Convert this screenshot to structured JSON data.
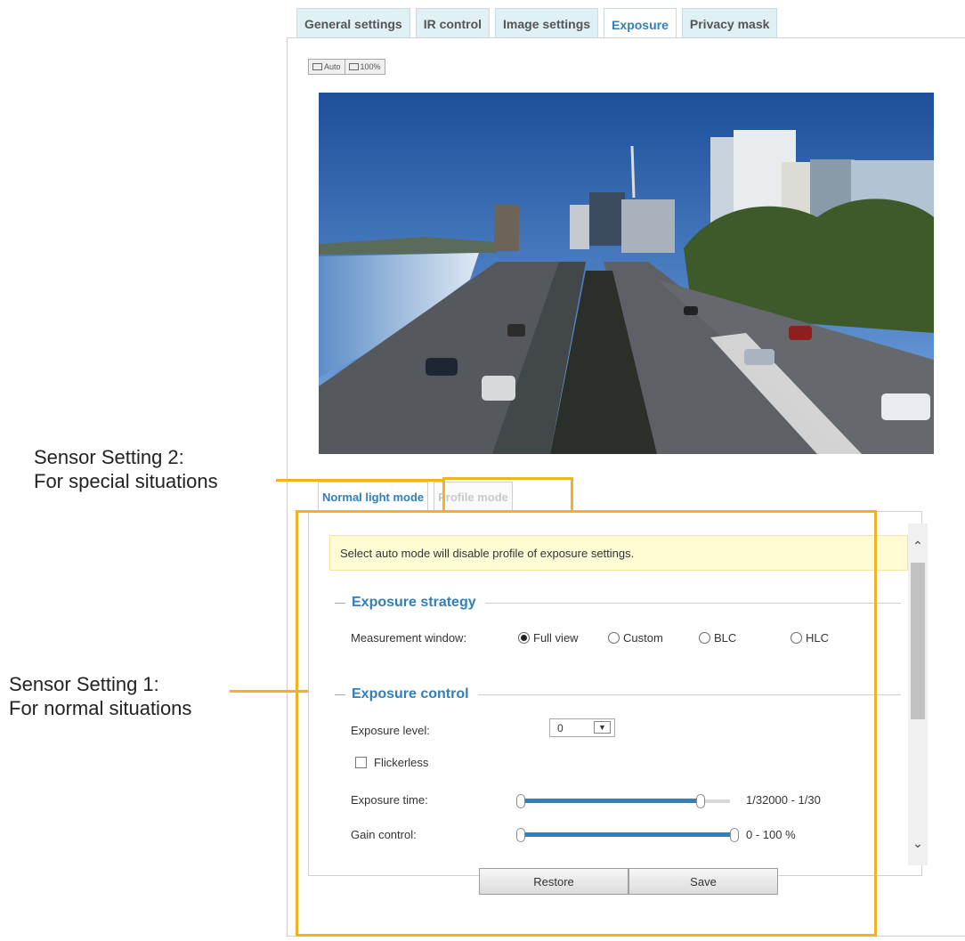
{
  "tabs": [
    {
      "label": "General settings",
      "active": false
    },
    {
      "label": "IR control",
      "active": false
    },
    {
      "label": "Image settings",
      "active": false
    },
    {
      "label": "Exposure",
      "active": true
    },
    {
      "label": "Privacy mask",
      "active": false
    }
  ],
  "view_buttons": {
    "auto": "Auto",
    "full": "100%"
  },
  "callouts": {
    "setting2_line1": "Sensor Setting 2:",
    "setting2_line2": "For special situations",
    "setting1_line1": "Sensor Setting 1:",
    "setting1_line2": "For normal situations"
  },
  "subtabs": {
    "normal": "Normal light mode",
    "profile": "Profile mode"
  },
  "notice": "Select auto mode will disable profile of exposure settings.",
  "exposure_strategy": {
    "title": "Exposure strategy",
    "measurement_label": "Measurement window:",
    "options": [
      "Full view",
      "Custom",
      "BLC",
      "HLC"
    ],
    "selected": "Full view"
  },
  "exposure_control": {
    "title": "Exposure control",
    "level_label": "Exposure level:",
    "level_value": "0",
    "flickerless_label": "Flickerless",
    "flickerless_checked": false,
    "time_label": "Exposure time:",
    "time_range": "1/32000 - 1/30",
    "time_fraction": 0.88,
    "gain_label": "Gain control:",
    "gain_range": "0 - 100 %",
    "gain_fraction": 1.0
  },
  "buttons": {
    "restore": "Restore",
    "save": "Save"
  },
  "colors": {
    "accent": "#2f7fb8",
    "highlight": "#f0b323",
    "notice_bg": "#fffbd4"
  }
}
